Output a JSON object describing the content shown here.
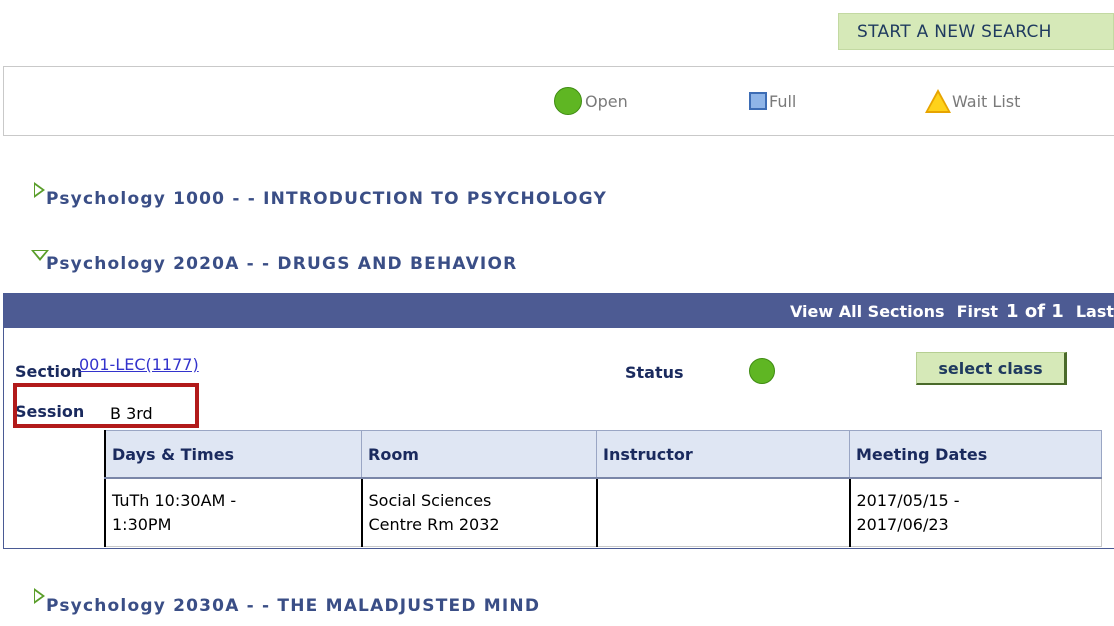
{
  "toolbar": {
    "new_search_label": "START A NEW SEARCH"
  },
  "legend": {
    "open_label": "Open",
    "full_label": "Full",
    "wait_label": "Wait List"
  },
  "courses": [
    {
      "title": "Psychology 1000 -  - INTRODUCTION TO  PSYCHOLOGY",
      "expanded": false
    },
    {
      "title": "Psychology 2020A -  - DRUGS AND BEHAVIOR",
      "expanded": true
    },
    {
      "title": "Psychology 2030A -  - THE MALADJUSTED MIND",
      "expanded": false
    }
  ],
  "section_panel": {
    "view_all": "View All Sections",
    "first": "First",
    "page": "1 of 1",
    "last": "Last",
    "section_label": "Section",
    "section_value": "001-LEC(1177)",
    "status_label": "Status",
    "status_value": "Open",
    "select_label": "select class",
    "session_label": "Session",
    "session_value": "B 3rd"
  },
  "meetings": {
    "headers": [
      "Days & Times",
      "Room",
      "Instructor",
      "Meeting Dates"
    ],
    "rows": [
      {
        "days_line1": "TuTh 10:30AM -",
        "days_line2": "1:30PM",
        "room_line1": "Social Sciences",
        "room_line2": "Centre Rm 2032",
        "instructor": "",
        "dates_line1": "2017/05/15 -",
        "dates_line2": "2017/06/23"
      }
    ]
  },
  "colors": {
    "accent_green": "#5fb623",
    "header_blue": "#4d5b93",
    "button_green": "#d6e9b8",
    "highlight_red": "#b21a1a"
  }
}
